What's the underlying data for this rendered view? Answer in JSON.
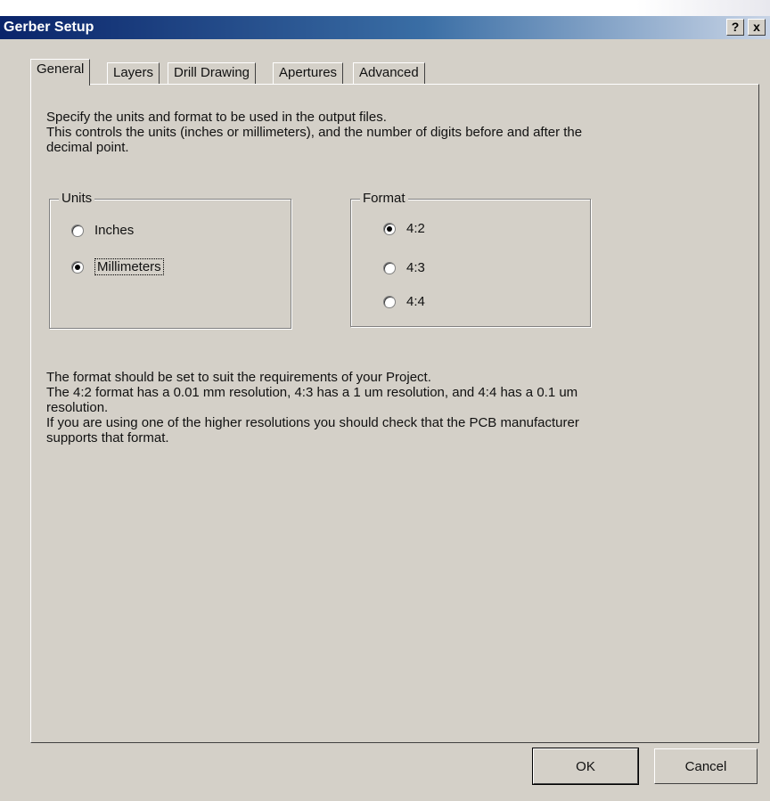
{
  "window": {
    "title": "Gerber Setup",
    "help_label": "?",
    "close_label": "x"
  },
  "tabs": [
    {
      "label": "General",
      "active": true
    },
    {
      "label": "Layers",
      "active": false
    },
    {
      "label": "Drill Drawing",
      "active": false
    },
    {
      "label": "Apertures",
      "active": false
    },
    {
      "label": "Advanced",
      "active": false
    }
  ],
  "description": [
    "Specify the units and format to be used in the output files.",
    "This controls the units (inches or millimeters), and the number of digits before and after the",
    "decimal point."
  ],
  "units": {
    "legend": "Units",
    "options": [
      {
        "label": "Inches",
        "selected": false
      },
      {
        "label": "Millimeters",
        "selected": true
      }
    ]
  },
  "format": {
    "legend": "Format",
    "options": [
      {
        "label": "4:2",
        "selected": true
      },
      {
        "label": "4:3",
        "selected": false
      },
      {
        "label": "4:4",
        "selected": false
      }
    ]
  },
  "note": [
    "The format should be set to suit the requirements of your Project.",
    "The 4:2 format has a 0.01 mm resolution, 4:3 has a 1 um resolution, and 4:4 has a 0.1 um",
    "resolution.",
    "If you are using one of the higher resolutions you should check that the PCB manufacturer",
    "supports that format."
  ],
  "buttons": {
    "ok": "OK",
    "cancel": "Cancel"
  }
}
